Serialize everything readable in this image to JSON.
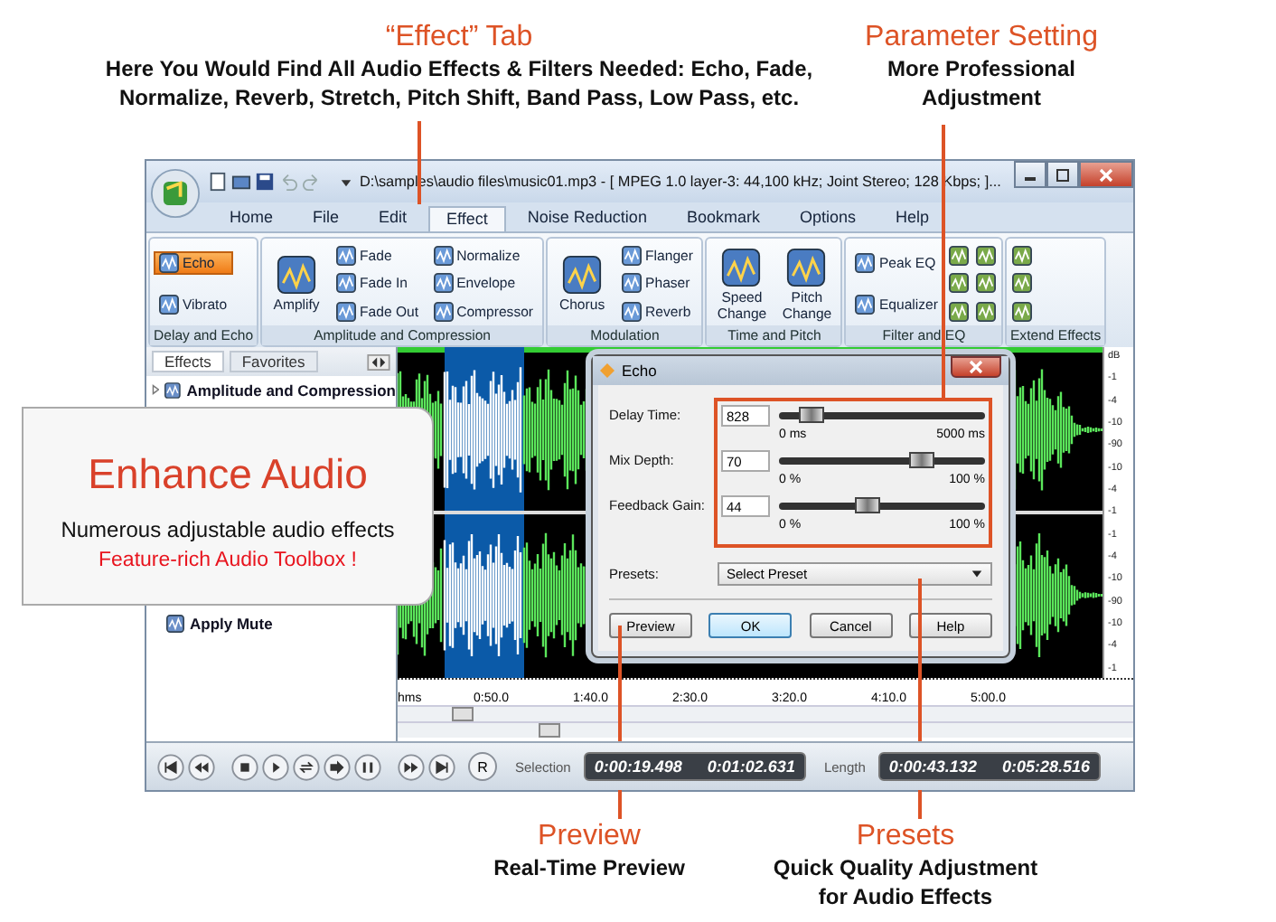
{
  "annotations_top": [
    {
      "title": "“Effect” Tab",
      "lines": [
        "Here You Would Find All Audio Effects & Filters Needed: Echo, Fade,",
        "Normalize, Reverb, Stretch, Pitch Shift, Band Pass, Low Pass, etc."
      ]
    },
    {
      "title": "Parameter Setting",
      "lines": [
        "More Professional",
        "Adjustment"
      ]
    }
  ],
  "window": {
    "title": "D:\\samples\\audio files\\music01.mp3 - [ MPEG 1.0 layer-3: 44,100 kHz; Joint Stereo; 128 Kbps;  ]..."
  },
  "tabs": [
    {
      "label": "Home",
      "selected": false
    },
    {
      "label": "File",
      "selected": false
    },
    {
      "label": "Edit",
      "selected": false
    },
    {
      "label": "Effect",
      "selected": true
    },
    {
      "label": "Noise Reduction",
      "selected": false
    },
    {
      "label": "Bookmark",
      "selected": false
    },
    {
      "label": "Options",
      "selected": false
    },
    {
      "label": "Help",
      "selected": false
    }
  ],
  "ribbon_groups": [
    {
      "label": "Delay and Echo",
      "columns": [
        [
          {
            "kind": "small",
            "label": "Echo",
            "selected": true
          },
          {
            "kind": "small",
            "label": "Vibrato",
            "selected": false
          }
        ]
      ]
    },
    {
      "label": "Amplitude and Compression",
      "columns": [
        [
          {
            "kind": "large",
            "label": "Amplify",
            "selected": false
          }
        ],
        [
          {
            "kind": "small",
            "label": "Fade",
            "selected": false
          },
          {
            "kind": "small",
            "label": "Fade In",
            "selected": false
          },
          {
            "kind": "small",
            "label": "Fade Out",
            "selected": false
          }
        ],
        [
          {
            "kind": "small",
            "label": "Normalize",
            "selected": false
          },
          {
            "kind": "small",
            "label": "Envelope",
            "selected": false
          },
          {
            "kind": "small",
            "label": "Compressor",
            "selected": false
          }
        ]
      ]
    },
    {
      "label": "Modulation",
      "columns": [
        [
          {
            "kind": "large",
            "label": "Chorus",
            "selected": false
          }
        ],
        [
          {
            "kind": "small",
            "label": "Flanger",
            "selected": false
          },
          {
            "kind": "small",
            "label": "Phaser",
            "selected": false
          },
          {
            "kind": "small",
            "label": "Reverb",
            "selected": false
          }
        ]
      ]
    },
    {
      "label": "Time and Pitch",
      "columns": [
        [
          {
            "kind": "large",
            "label": "Speed Change",
            "selected": false
          }
        ],
        [
          {
            "kind": "large",
            "label": "Pitch Change",
            "selected": false
          }
        ]
      ]
    },
    {
      "label": "Filter and EQ",
      "columns": [
        [
          {
            "kind": "small",
            "label": "Peak EQ",
            "selected": false
          },
          {
            "kind": "small",
            "label": "Equalizer",
            "selected": false
          }
        ],
        [
          {
            "kind": "icon",
            "selected": false
          },
          {
            "kind": "icon",
            "selected": false
          },
          {
            "kind": "icon",
            "selected": false
          }
        ],
        [
          {
            "kind": "icon",
            "selected": false
          },
          {
            "kind": "icon",
            "selected": false
          },
          {
            "kind": "icon",
            "selected": false
          }
        ]
      ]
    },
    {
      "label": "Extend Effects",
      "columns": [
        [
          {
            "kind": "icon",
            "selected": false
          },
          {
            "kind": "icon",
            "selected": false
          },
          {
            "kind": "icon",
            "selected": false
          }
        ]
      ]
    }
  ],
  "sidebar": {
    "tabs": [
      {
        "label": "Effects",
        "selected": true
      },
      {
        "label": "Favorites",
        "selected": false
      }
    ],
    "items": [
      {
        "label": "Amplitude and Compression",
        "kind": "category"
      },
      {
        "label": "Apply Mute",
        "kind": "action"
      }
    ]
  },
  "db_scale": [
    "dB",
    "-1",
    "-4",
    "-10",
    "-90",
    "-10",
    "-4",
    "-1",
    "-1",
    "-4",
    "-10",
    "-90",
    "-10",
    "-4",
    "-1"
  ],
  "timeline": [
    "hms",
    "0:50.0",
    "1:40.0",
    "2:30.0",
    "3:20.0",
    "4:10.0",
    "5:00.0"
  ],
  "transport": {
    "record_label": "R",
    "selection_label": "Selection",
    "selection": [
      "0:00:19.498",
      "0:01:02.631"
    ],
    "length_label": "Length",
    "length": [
      "0:00:43.132",
      "0:05:28.516"
    ]
  },
  "dialog": {
    "title": "Echo",
    "params": [
      {
        "label": "Delay Time:",
        "value": "828",
        "level": 0.17,
        "min": "0 ms",
        "max": "5000 ms"
      },
      {
        "label": "Mix Depth:",
        "value": "70",
        "level": 0.7,
        "min": "0 %",
        "max": "100 %"
      },
      {
        "label": "Feedback Gain:",
        "value": "44",
        "level": 0.44,
        "min": "0 %",
        "max": "100 %"
      }
    ],
    "presets_label": "Presets:",
    "presets_value": "Select Preset",
    "buttons": [
      {
        "label": "Preview",
        "default": false
      },
      {
        "label": "OK",
        "default": true
      },
      {
        "label": "Cancel",
        "default": false
      },
      {
        "label": "Help",
        "default": false
      }
    ]
  },
  "callout": {
    "title": "Enhance Audio",
    "line": "Numerous adjustable audio effects",
    "highlight": "Feature-rich Audio Toolbox !"
  },
  "annotations_bottom": [
    {
      "title": "Preview",
      "lines": [
        "Real-Time Preview"
      ]
    },
    {
      "title": "Presets",
      "lines": [
        "Quick Quality Adjustment",
        "for Audio Effects"
      ]
    }
  ]
}
